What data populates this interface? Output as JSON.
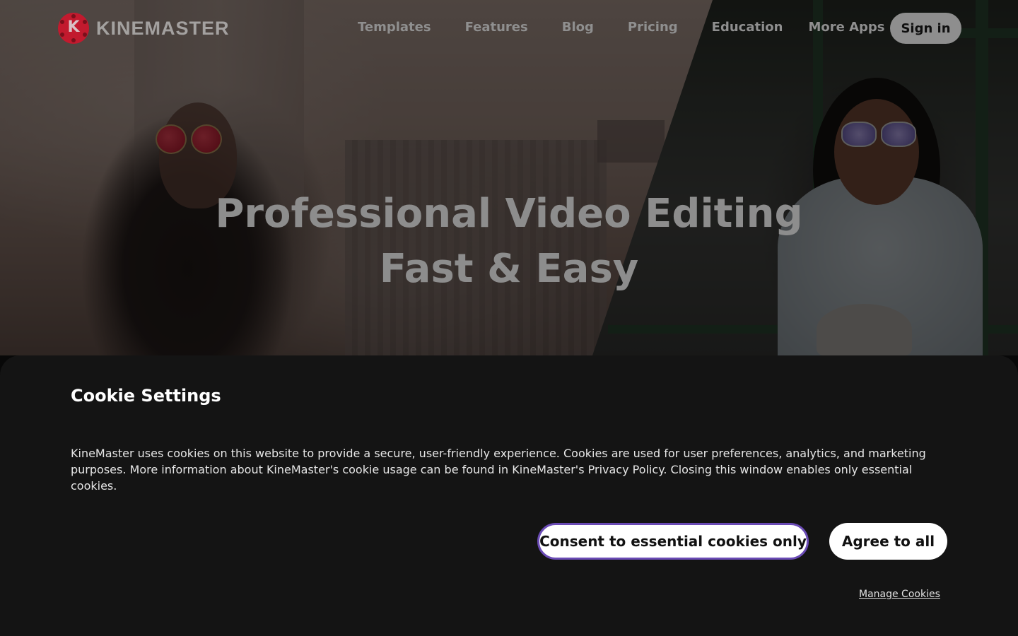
{
  "header": {
    "logo_text": "KINEMASTER",
    "nav": [
      "Templates",
      "Features",
      "Blog",
      "Pricing",
      "Education"
    ],
    "more_apps": "More Apps",
    "signin_label": "Sign in"
  },
  "hero": {
    "line1": "Professional Video Editing",
    "line2": "Fast & Easy"
  },
  "cookie": {
    "title": "Cookie Settings",
    "body": "KineMaster uses cookies on this website to provide a secure, user-friendly experience. Cookies are used for user preferences, analytics, and marketing purposes. More information about KineMaster's cookie usage can be found in KineMaster's Privacy Policy. Closing this window enables only essential cookies.",
    "btn_essential": "Consent to essential cookies only",
    "btn_agree": "Agree to all",
    "manage": "Manage Cookies"
  },
  "colors": {
    "brand_red": "#c21a2e",
    "focus_outline": "#6a4bb5",
    "modal_bg": "#141414"
  },
  "icons": [
    "kinemaster-logo-icon",
    "chevron-down-icon"
  ]
}
